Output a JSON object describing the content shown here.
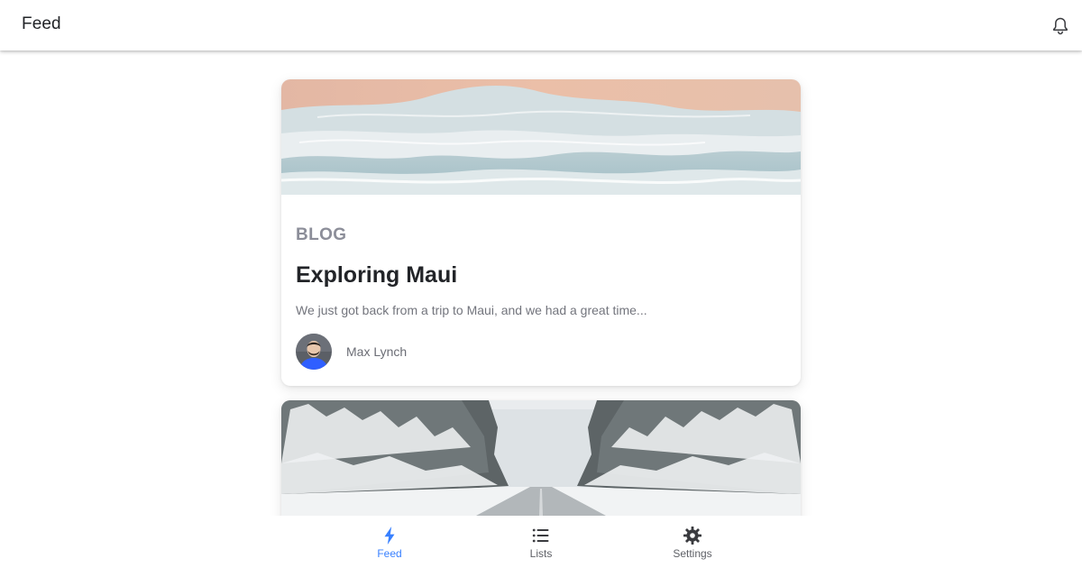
{
  "header": {
    "title": "Feed",
    "notifications_icon": "bell-icon"
  },
  "feed": {
    "cards": [
      {
        "category": "BLOG",
        "title": "Exploring Maui",
        "excerpt": "We just got back from a trip to Maui, and we had a great time...",
        "author": "Max Lynch",
        "image": "aerial beach waves"
      },
      {
        "image": "snowy forest road"
      }
    ]
  },
  "tabs": [
    {
      "label": "Feed",
      "icon": "flash-icon",
      "selected": true
    },
    {
      "label": "Lists",
      "icon": "list-icon",
      "selected": false
    },
    {
      "label": "Settings",
      "icon": "cog-icon",
      "selected": false
    }
  ],
  "colors": {
    "accent": "#3880ff",
    "text_primary": "#222428",
    "text_muted": "#73757d",
    "category": "#8c8e99",
    "tab_inactive": "#5f6167"
  }
}
